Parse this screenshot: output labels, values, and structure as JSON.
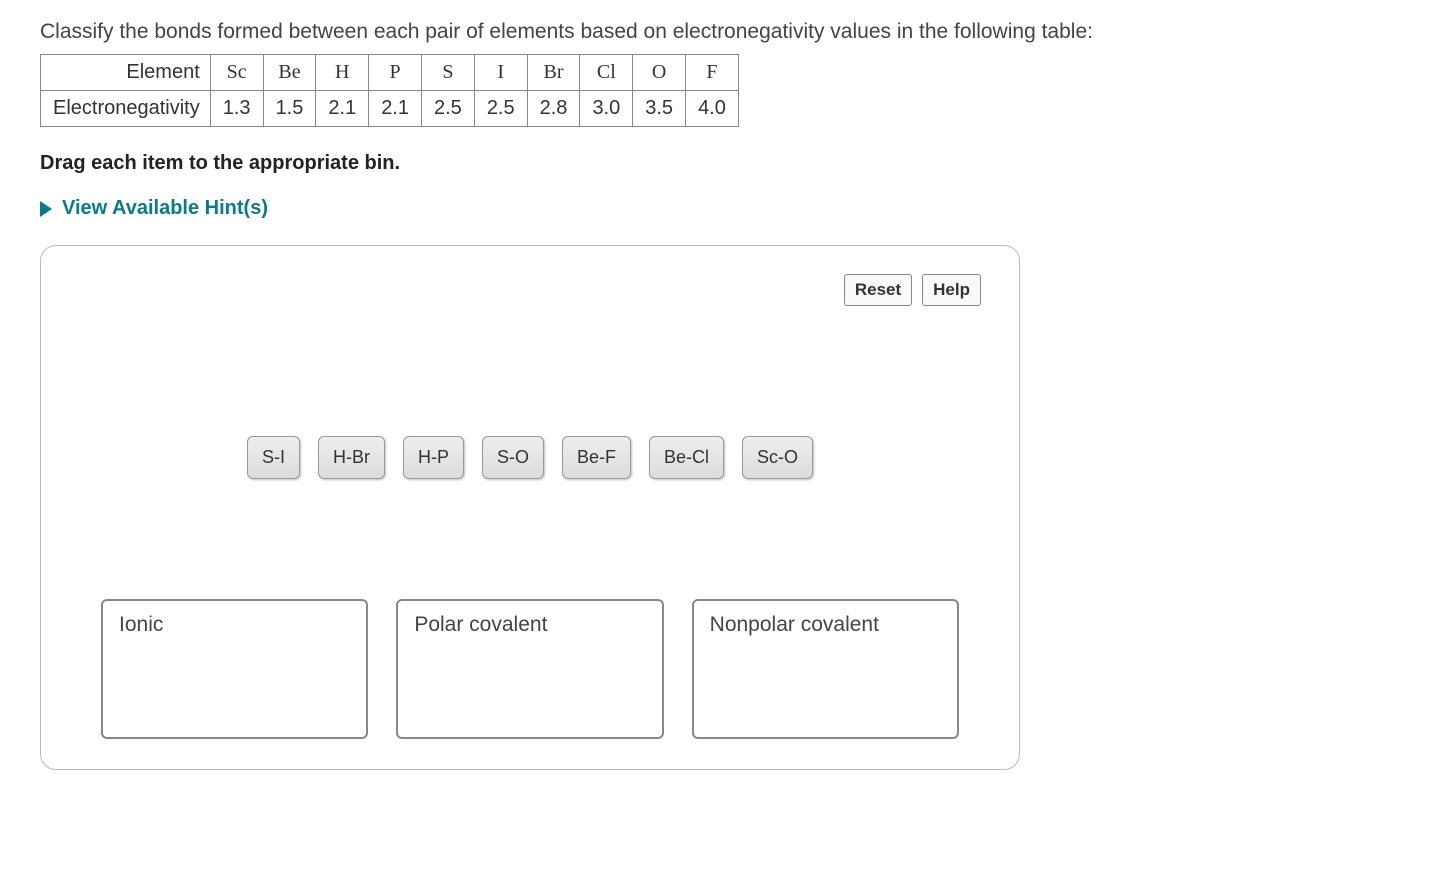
{
  "question": {
    "prompt": "Classify the bonds formed between each pair of elements based on electronegativity values in the following table:",
    "instruction": "Drag each item to the appropriate bin.",
    "hints_label": "View Available Hint(s)"
  },
  "table": {
    "row1_label": "Element",
    "row2_label": "Electronegativity",
    "elements": [
      "Sc",
      "Be",
      "H",
      "P",
      "S",
      "I",
      "Br",
      "Cl",
      "O",
      "F"
    ],
    "values": [
      "1.3",
      "1.5",
      "2.1",
      "2.1",
      "2.5",
      "2.5",
      "2.8",
      "3.0",
      "3.5",
      "4.0"
    ]
  },
  "toolbar": {
    "reset_label": "Reset",
    "help_label": "Help"
  },
  "draggables": [
    {
      "label": "S-I"
    },
    {
      "label": "H-Br"
    },
    {
      "label": "H-P"
    },
    {
      "label": "S-O"
    },
    {
      "label": "Be-F"
    },
    {
      "label": "Be-Cl"
    },
    {
      "label": "Sc-O"
    }
  ],
  "bins": [
    {
      "title": "Ionic"
    },
    {
      "title": "Polar covalent"
    },
    {
      "title": "Nonpolar covalent"
    }
  ]
}
